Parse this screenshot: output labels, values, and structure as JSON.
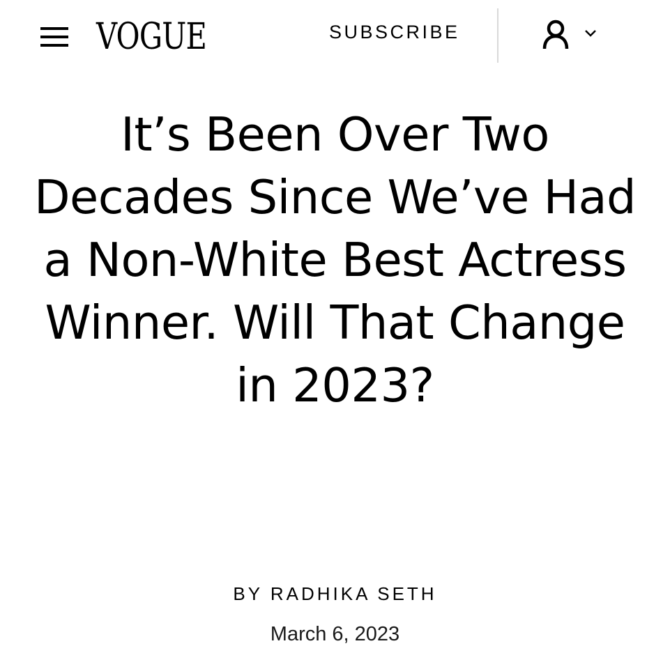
{
  "header": {
    "logo": "VOGUE",
    "subscribe_label": "SUBSCRIBE",
    "menu_icon": "hamburger-menu-icon",
    "account_icon": "user-icon",
    "account_chevron_icon": "chevron-down-icon"
  },
  "article": {
    "headline": "It’s Been Over Two Decades Since We’ve Had a Non-White Best Actress Winner. Will That Change in 2023?",
    "byline": "BY RADHIKA SETH",
    "date": "March 6, 2023"
  },
  "colors": {
    "text": "#000000",
    "background": "#ffffff",
    "divider": "#d9d9d9"
  }
}
